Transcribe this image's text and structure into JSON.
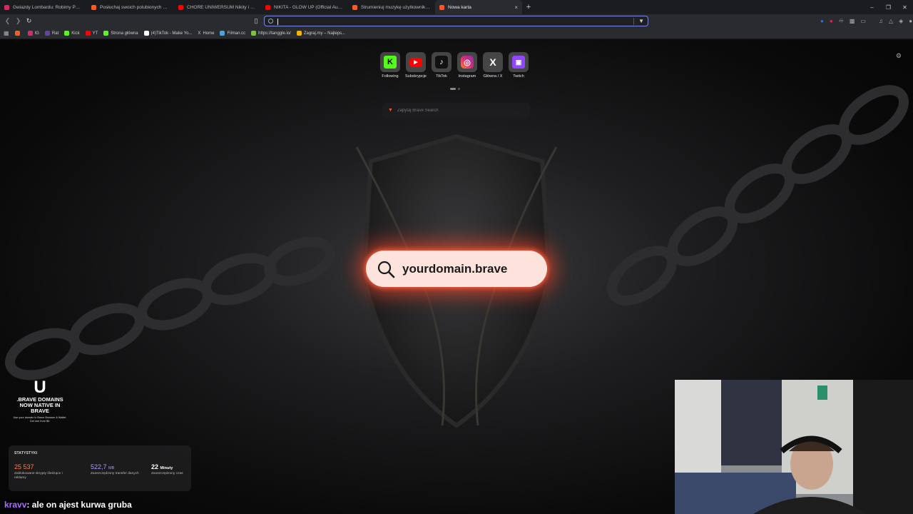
{
  "tabs": [
    {
      "title": "Gwiazdy Lombardu: Robimy PRAWO...",
      "favicon_color": "#e0245e",
      "active": false
    },
    {
      "title": "Posłuchaj swoich polubionych utwo...",
      "favicon_color": "#ff5a1f",
      "active": false
    },
    {
      "title": "CHORE UNIWERSUM Nikity i Camer...",
      "favicon_color": "#ff0000",
      "active": false
    },
    {
      "title": "NIKITA - GLOW UP (Official Audio) -",
      "favicon_color": "#ff0000",
      "active": false
    },
    {
      "title": "Strumieniuj muzykę użytkownika ku...",
      "favicon_color": "#ff5a1f",
      "active": false
    },
    {
      "title": "Nowa karta",
      "favicon_color": "#fb542b",
      "active": true
    }
  ],
  "toolbar": {
    "address_value": "",
    "new_tab_glyph": "+",
    "close_glyph": "×"
  },
  "bookmarks": [
    {
      "label": "",
      "color": "#ff5a1f"
    },
    {
      "label": "IG",
      "color": "#d62976"
    },
    {
      "label": "Rat",
      "color": "#6441a5"
    },
    {
      "label": "Kick",
      "color": "#53fc18"
    },
    {
      "label": "YT",
      "color": "#ff0000"
    },
    {
      "label": "Strona główna",
      "color": "#53fc18"
    },
    {
      "label": "(4)TikTok - Make Yo...",
      "color": "#ffffff"
    },
    {
      "label": "Home",
      "color": "#ffffff"
    },
    {
      "label": "Filman.cc",
      "color": "#4aa3df"
    },
    {
      "label": "https://tanggle.io/",
      "color": "#7cc242"
    },
    {
      "label": "Zagraj.my – Najleps...",
      "color": "#f5b400"
    }
  ],
  "top_sites": [
    {
      "label": "Following",
      "icon": "kick-icon",
      "glyph": "K",
      "color": "#53fc18"
    },
    {
      "label": "Subskrypcje",
      "icon": "youtube-icon",
      "glyph": "▶",
      "color": "#ff0000"
    },
    {
      "label": "TikTok",
      "icon": "tiktok-icon",
      "glyph": "♪",
      "color": "#111111"
    },
    {
      "label": "Instagram",
      "icon": "instagram-icon",
      "glyph": "◎",
      "color": "#d62976"
    },
    {
      "label": "Główna / X",
      "icon": "x-icon",
      "glyph": "X",
      "color": "#111111"
    },
    {
      "label": "Twitch",
      "icon": "twitch-icon",
      "glyph": "▣",
      "color": "#9146ff"
    }
  ],
  "search": {
    "placeholder": "Zapytaj Brave Search"
  },
  "sponsored": {
    "domain_text": "yourdomain.brave"
  },
  "promo": {
    "logo": "U",
    "headline": ".BRAVE DOMAINS NOW NATIVE IN BRAVE",
    "subtext": "Use your domain in Brave Browser & Wallet. Get one from $5."
  },
  "stats": {
    "title": "STATYSTYKI",
    "items": [
      {
        "value": "25 537",
        "unit": "",
        "desc": "Zablokowane skrypty śledzące i reklamy",
        "color": "#ff7a45"
      },
      {
        "value": "522,7",
        "unit": "MB",
        "desc": "Zaoszczędzony transfer danych",
        "color": "#a8a0ff"
      },
      {
        "value": "22",
        "unit": "Minuty",
        "desc": "Zaoszczędzony czas",
        "color": "#ffffff"
      }
    ]
  },
  "chat": {
    "user": "kravv",
    "message": ": ale on ajest kurwa gruba"
  }
}
